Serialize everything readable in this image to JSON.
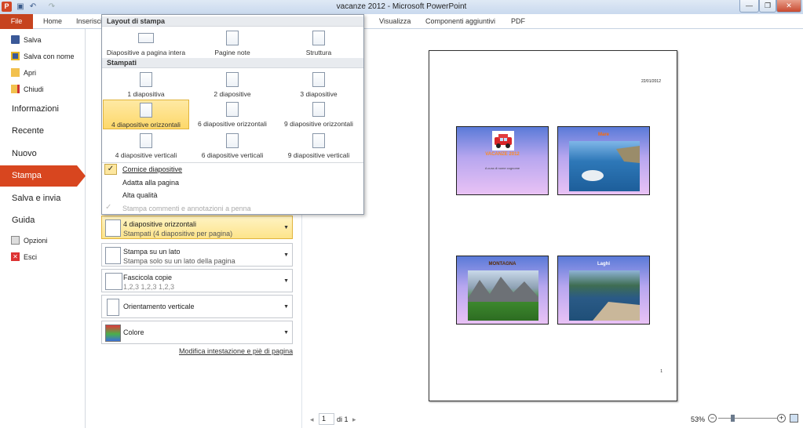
{
  "window": {
    "title": "vacanze 2012  -  Microsoft PowerPoint",
    "app_icon": "P"
  },
  "ribbon": {
    "file": "File",
    "tabs": [
      "Home",
      "Inserisci",
      "Visualizza",
      "Componenti aggiuntivi",
      "PDF"
    ]
  },
  "backstage": {
    "commands": [
      "Salva",
      "Salva con nome",
      "Apri",
      "Chiudi"
    ],
    "tabs": [
      "Informazioni",
      "Recente",
      "Nuovo"
    ],
    "selected": "Stampa",
    "tabs2": [
      "Salva e invia",
      "Guida"
    ],
    "bottom": [
      "Opzioni",
      "Esci"
    ]
  },
  "popup": {
    "section1": "Layout di stampa",
    "layouts": [
      "Diapositive a pagina intera",
      "Pagine note",
      "Struttura"
    ],
    "section2": "Stampati",
    "handouts": [
      "1 diapositiva",
      "2 diapositive",
      "3 diapositive",
      "4 diapositive orizzontali",
      "6 diapositive orizzontali",
      "9 diapositive orizzontali",
      "4 diapositive verticali",
      "6 diapositive verticali",
      "9 diapositive verticali"
    ],
    "toggles": [
      "Cornice diapositive",
      "Adatta alla pagina",
      "Alta qualità",
      "Stampa commenti e annotazioni a penna"
    ]
  },
  "settings": {
    "layout_title": "4 diapositive orizzontali",
    "layout_sub": "Stampati (4 diapositive per pagina)",
    "sides_title": "Stampa su un lato",
    "sides_sub": "Stampa solo su un lato della pagina",
    "collate_title": "Fascicola copie",
    "collate_sub": "1,2,3    1,2,3    1,2,3",
    "orientation": "Orientamento verticale",
    "color": "Colore",
    "header_footer_link": "Modifica intestazione e piè di pagina"
  },
  "preview": {
    "date": "22/01/2012",
    "page_number": "1",
    "slides": [
      "VACANZE 2012",
      "Mare",
      "MONTAGNA",
      "Laghi"
    ],
    "slide1_sub": "A cura di nome cognome"
  },
  "status": {
    "page": "1",
    "of": "di 1",
    "zoom": "53%"
  }
}
